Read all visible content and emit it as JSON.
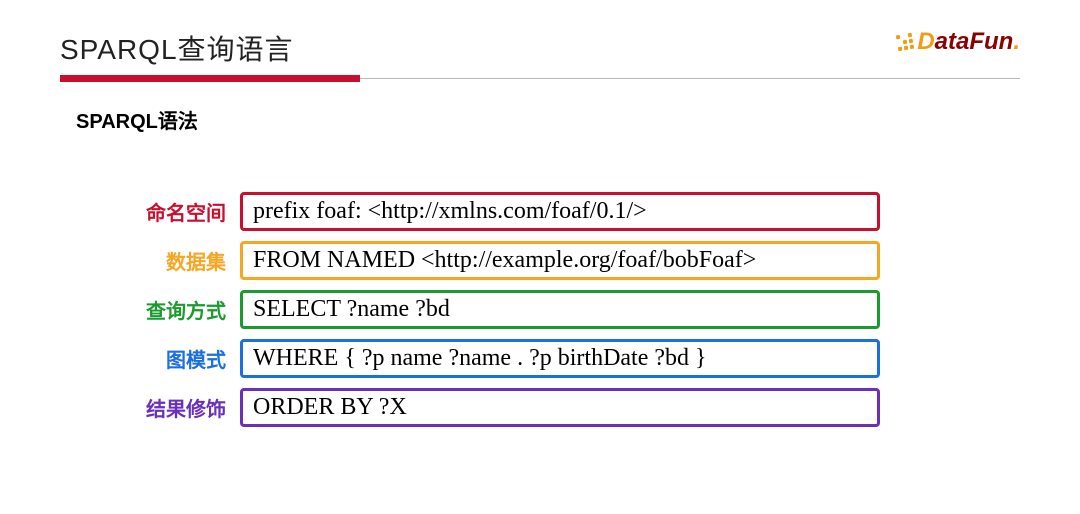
{
  "header": {
    "title": "SPARQL查询语言",
    "logo": {
      "part1": "D",
      "part2": "ataFun",
      "dot": "."
    }
  },
  "subtitle": "SPARQL语法",
  "rows": [
    {
      "label": "命名空间",
      "box": "prefix foaf: <http://xmlns.com/foaf/0.1/>"
    },
    {
      "label": "数据集",
      "box": "FROM NAMED <http://example.org/foaf/bobFoaf>"
    },
    {
      "label": "查询方式",
      "box": "SELECT ?name ?bd"
    },
    {
      "label": "图模式",
      "box": "WHERE { ?p name ?name . ?p birthDate ?bd }"
    },
    {
      "label": "结果修饰",
      "box": "ORDER BY ?X"
    }
  ]
}
